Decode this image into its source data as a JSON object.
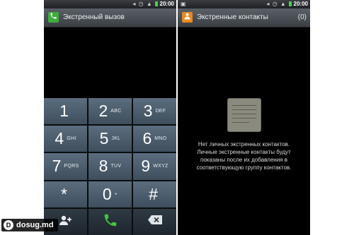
{
  "left_screen": {
    "status": {
      "time": "20:00",
      "icons": [
        "mute-icon",
        "alarm-icon",
        "signal-icon",
        "battery-icon"
      ]
    },
    "title": "Экстренный вызов",
    "title_icon": "phone-icon",
    "keys": [
      {
        "digit": "1",
        "letters": ""
      },
      {
        "digit": "2",
        "letters": "ABC"
      },
      {
        "digit": "3",
        "letters": "DEF"
      },
      {
        "digit": "4",
        "letters": "GHI"
      },
      {
        "digit": "5",
        "letters": "JKL"
      },
      {
        "digit": "6",
        "letters": "MNO"
      },
      {
        "digit": "7",
        "letters": "PQRS"
      },
      {
        "digit": "8",
        "letters": "TUV"
      },
      {
        "digit": "9",
        "letters": "WXYZ"
      },
      {
        "digit": "*",
        "letters": ""
      },
      {
        "digit": "0",
        "letters": "+"
      },
      {
        "digit": "#",
        "letters": ""
      }
    ],
    "bottom_actions": [
      "add-contact-icon",
      "call-icon",
      "backspace-icon"
    ]
  },
  "right_screen": {
    "status": {
      "time": "20:00",
      "icons": [
        "image-icon",
        "mute-icon",
        "alarm-icon",
        "signal-icon",
        "battery-icon"
      ]
    },
    "title": "Экстренные контакты",
    "title_icon": "contacts-icon",
    "count": "(0)",
    "empty_lines": [
      "Нет личных экстренных контактов.",
      "Личные экстренные контакты будут",
      "показаны после их добавления в",
      "соответствующую группу контактов."
    ]
  },
  "watermark": {
    "logo": "D",
    "text": "dosug.md"
  },
  "colors": {
    "title_bar": "#4a5057",
    "key_bg": "#4f6172",
    "call_green": "#3fca3a",
    "battery_green": "#48d24a",
    "contacts_orange": "#e8891f"
  }
}
